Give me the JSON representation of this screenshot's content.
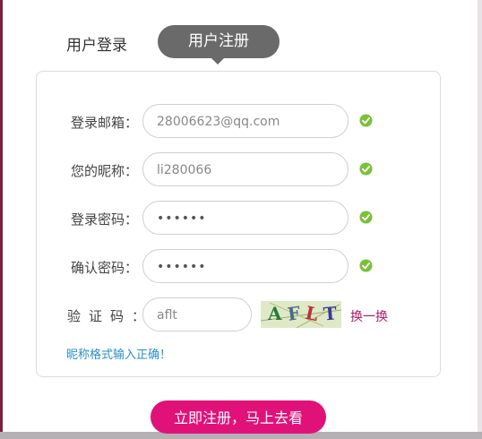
{
  "tabs": {
    "login_label": "用户登录",
    "register_label": "用户注册"
  },
  "form": {
    "email": {
      "label": "登录邮箱：",
      "value": "28006623@qq.com"
    },
    "nickname": {
      "label": "您的昵称：",
      "value": "li280066"
    },
    "password": {
      "label": "登录密码：",
      "value": "••••••"
    },
    "confirm": {
      "label": "确认密码：",
      "value": "••••••"
    },
    "captcha": {
      "label": "验证码：",
      "value": "aflt",
      "image_text": [
        "A",
        "F",
        "L",
        "T"
      ],
      "refresh_label": "换一换"
    },
    "hint": "昵称格式输入正确！"
  },
  "submit_label": "立即注册，马上去看",
  "colors": {
    "accent": "#e0127a",
    "tab_active": "#6a6a6a",
    "check": "#7ac03a",
    "hint": "#2a8fc6"
  },
  "icons": {
    "valid": "check-circle-icon"
  }
}
